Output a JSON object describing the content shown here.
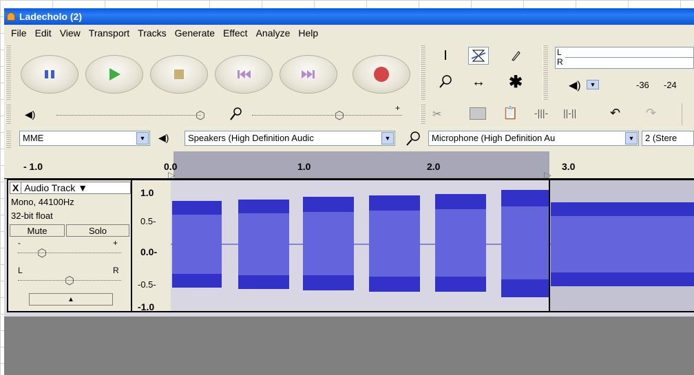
{
  "window": {
    "title": "Ladecholo (2)"
  },
  "menu": [
    "File",
    "Edit",
    "View",
    "Transport",
    "Tracks",
    "Generate",
    "Effect",
    "Analyze",
    "Help"
  ],
  "transport": [
    "pause-icon",
    "play-icon",
    "stop-icon",
    "skip-start-icon",
    "skip-end-icon",
    "record-icon"
  ],
  "tools": [
    "selection-tool",
    "envelope-tool",
    "draw-tool",
    "zoom-tool",
    "timeshift-tool",
    "multi-tool"
  ],
  "meter": {
    "l_label": "L",
    "r_label": "R",
    "scale": [
      "-36",
      "-24"
    ]
  },
  "mixer": {
    "plus": "+",
    "minus": "-"
  },
  "edit_tools": [
    "cut-icon",
    "copy-icon",
    "paste-icon",
    "trim-icon",
    "silence-icon",
    "undo-icon",
    "redo-icon"
  ],
  "devices": {
    "host": "MME",
    "output": "Speakers (High Definition Audic",
    "input": "Microphone (High Definition Au",
    "channels": "2 (Stere"
  },
  "ruler": {
    "labels": [
      "- 1.0",
      "0.0",
      "1.0",
      "2.0",
      "3.0"
    ]
  },
  "track": {
    "name": "Audio Track",
    "format": "Mono, 44100Hz",
    "bitdepth": "32-bit float",
    "mute": "Mute",
    "solo": "Solo",
    "gain_minus": "-",
    "gain_plus": "+",
    "pan_left": "L",
    "pan_right": "R",
    "close": "X",
    "scale": [
      "1.0",
      "0.5-",
      "0.0-",
      "-0.5-",
      "-1.0"
    ]
  },
  "colors": {
    "waveform": "#3232c8",
    "waveform_rms": "#6464dc",
    "selection": "#a8a7b7",
    "title_bar": "#0a5ae8"
  }
}
